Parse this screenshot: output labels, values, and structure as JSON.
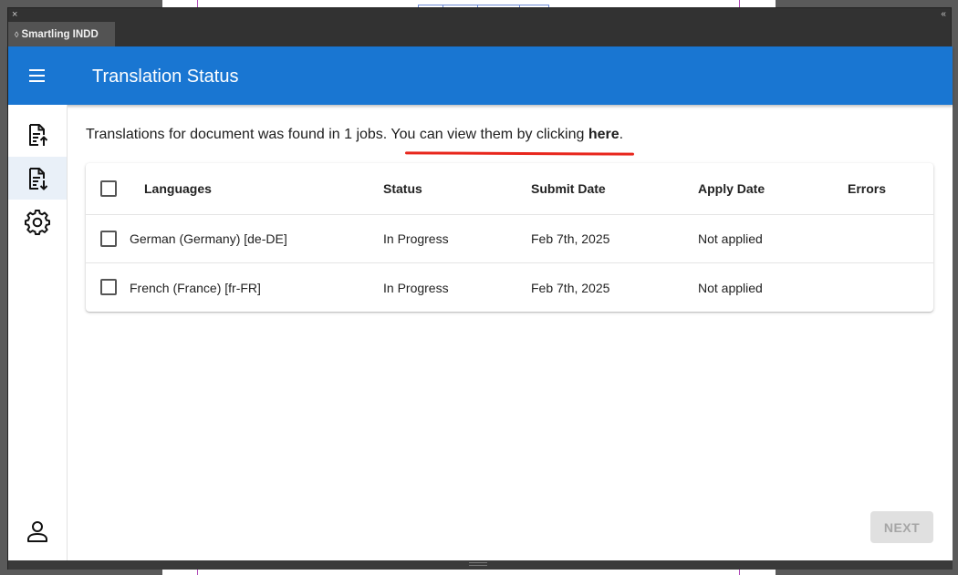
{
  "panel": {
    "close_glyph": "×",
    "collapse_glyph": "‹‹",
    "tab_arrows": "◊",
    "tab_label": "Smartling INDD"
  },
  "appbar": {
    "title": "Translation Status",
    "menu_icon": "menu-icon",
    "color": "#1976d2"
  },
  "sidenav": {
    "items": [
      {
        "icon": "document-upload-icon",
        "active": false
      },
      {
        "icon": "document-download-icon",
        "active": true
      },
      {
        "icon": "settings-gear-icon",
        "active": false
      },
      {
        "icon": "account-icon",
        "active": false
      }
    ]
  },
  "info": {
    "text": "Translations for document was found in 1 jobs. You can view them by clicking ",
    "link": "here",
    "suffix": "."
  },
  "table": {
    "columns": [
      "Languages",
      "Status",
      "Submit Date",
      "Apply Date",
      "Errors"
    ],
    "rows": [
      {
        "language": "German (Germany) [de-DE]",
        "status": "In Progress",
        "submit_date": "Feb 7th, 2025",
        "apply_date": "Not applied",
        "errors": ""
      },
      {
        "language": "French (France) [fr-FR]",
        "status": "In Progress",
        "submit_date": "Feb 7th, 2025",
        "apply_date": "Not applied",
        "errors": ""
      }
    ]
  },
  "actions": {
    "next_label": "NEXT",
    "next_disabled": true
  },
  "colors": {
    "accent": "#1976d2",
    "annotation": "#e8261c"
  }
}
